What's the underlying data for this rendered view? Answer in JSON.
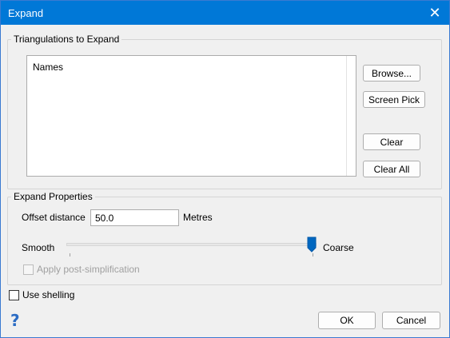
{
  "window": {
    "title": "Expand",
    "close_label": "✕"
  },
  "triangulations": {
    "group_label": "Triangulations to Expand",
    "list_header": "Names",
    "browse_label": "Browse...",
    "screen_pick_label": "Screen Pick",
    "clear_label": "Clear",
    "clear_all_label": "Clear All"
  },
  "properties": {
    "group_label": "Expand Properties",
    "offset_label": "Offset distance",
    "offset_value": "50.0",
    "offset_unit": "Metres",
    "smooth_label": "Smooth",
    "coarse_label": "Coarse",
    "slider_level": 1.0,
    "post_simplification_label": "Apply post-simplification",
    "post_simplification_checked": false,
    "post_simplification_enabled": false
  },
  "use_shelling": {
    "label": "Use shelling",
    "checked": false
  },
  "footer": {
    "help_icon": "question-mark-icon",
    "help_glyph": "?",
    "ok_label": "OK",
    "cancel_label": "Cancel"
  },
  "colors": {
    "titlebar": "#0078d7",
    "accent": "#0067c0"
  }
}
